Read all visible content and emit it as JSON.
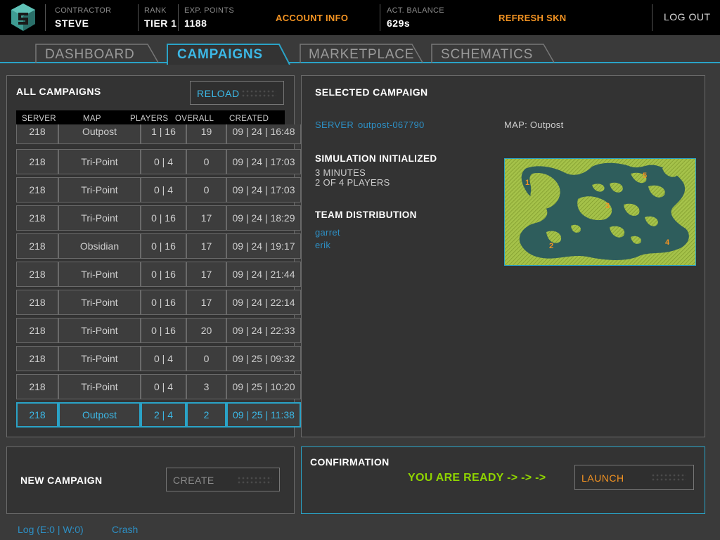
{
  "topbar": {
    "contractor_label": "CONTRACTOR",
    "contractor_value": "STEVE",
    "rank_label": "RANK",
    "rank_value": "TIER 1",
    "exp_label": "EXP. POINTS",
    "exp_value": "1188",
    "account_info": "ACCOUNT INFO",
    "balance_label": "ACT. BALANCE",
    "balance_value": "629s",
    "refresh": "REFRESH SKN",
    "logout": "LOG OUT"
  },
  "tabs": [
    {
      "label": "DASHBOARD",
      "active": false
    },
    {
      "label": "CAMPAIGNS",
      "active": true
    },
    {
      "label": "MARKETPLACE",
      "active": false
    },
    {
      "label": "SCHEMATICS",
      "active": false
    }
  ],
  "campaigns": {
    "title": "ALL CAMPAIGNS",
    "reload": "RELOAD",
    "columns": [
      "SERVER",
      "MAP",
      "PLAYERS",
      "OVERALL",
      "CREATED"
    ],
    "rows": [
      [
        "218",
        "Outpost",
        "1 | 16",
        "19",
        "09 | 24 | 16:48"
      ],
      [
        "218",
        "Tri-Point",
        "0 | 4",
        "0",
        "09 | 24 | 17:03"
      ],
      [
        "218",
        "Tri-Point",
        "0 | 4",
        "0",
        "09 | 24 | 17:03"
      ],
      [
        "218",
        "Tri-Point",
        "0 | 16",
        "17",
        "09 | 24 | 18:29"
      ],
      [
        "218",
        "Obsidian",
        "0 | 16",
        "17",
        "09 | 24 | 19:17"
      ],
      [
        "218",
        "Tri-Point",
        "0 | 16",
        "17",
        "09 | 24 | 21:44"
      ],
      [
        "218",
        "Tri-Point",
        "0 | 16",
        "17",
        "09 | 24 | 22:14"
      ],
      [
        "218",
        "Tri-Point",
        "0 | 16",
        "20",
        "09 | 24 | 22:33"
      ],
      [
        "218",
        "Tri-Point",
        "0 | 4",
        "0",
        "09 | 25 | 09:32"
      ],
      [
        "218",
        "Tri-Point",
        "0 | 4",
        "3",
        "09 | 25 | 10:20"
      ],
      [
        "218",
        "Outpost",
        "2 | 4",
        "2",
        "09 | 25 | 11:38"
      ]
    ],
    "selected_index": 10
  },
  "selected": {
    "title": "SELECTED CAMPAIGN",
    "server_label": "SERVER",
    "server_value": "outpost-067790",
    "map_label": "MAP: Outpost",
    "sim_title": "SIMULATION INITIALIZED",
    "sim_line1": "3 MINUTES",
    "sim_line2": "2 OF 4 PLAYERS",
    "team_title": "TEAM DISTRIBUTION",
    "team": [
      "garret",
      "erik"
    ],
    "map_markers": [
      "1",
      "2",
      "3",
      "4",
      "5"
    ]
  },
  "new_campaign": {
    "title": "NEW CAMPAIGN",
    "create": "CREATE"
  },
  "confirmation": {
    "title": "CONFIRMATION",
    "ready": "YOU ARE READY -> -> ->",
    "launch": "LAUNCH"
  },
  "footer": {
    "log": "Log (E:0 | W:0)",
    "crash": "Crash"
  },
  "colors": {
    "accent_blue": "#2aa3c7",
    "orange": "#f39322",
    "ready_green": "#8fd400",
    "map_water": "#2e5d5c",
    "map_land": "#a5c24a"
  }
}
